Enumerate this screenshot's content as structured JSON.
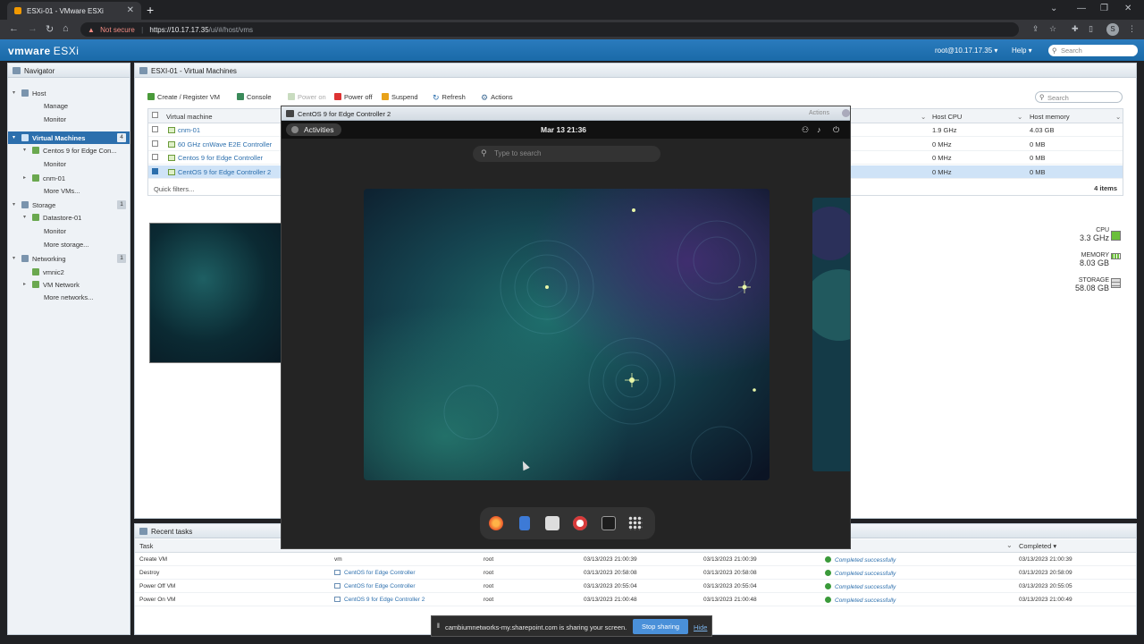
{
  "browser": {
    "tab_title": "ESXi-01 - VMware ESXi",
    "not_secure": "Not secure",
    "url_scheme": "https://",
    "url_host": "10.17.17.35",
    "url_path": "/ui/#/host/vms",
    "avatar_letter": "S"
  },
  "header": {
    "brand": "vmware",
    "product": "ESXi",
    "user": "root@10.17.17.35 ▾",
    "help": "Help ▾",
    "search_placeholder": "Search"
  },
  "navigator": {
    "title": "Navigator",
    "items": [
      {
        "label": "Host",
        "level": 0,
        "toggle": "▾"
      },
      {
        "label": "Manage",
        "level": 2
      },
      {
        "label": "Monitor",
        "level": 2
      },
      {
        "label": "Virtual Machines",
        "level": 0,
        "toggle": "▾",
        "badge": "4",
        "selected": true
      },
      {
        "label": "Centos 9 for Edge Con...",
        "level": 1,
        "toggle": "▾"
      },
      {
        "label": "Monitor",
        "level": 2
      },
      {
        "label": "cnm-01",
        "level": 1,
        "toggle": "▸"
      },
      {
        "label": "More VMs...",
        "level": 2
      },
      {
        "label": "Storage",
        "level": 0,
        "toggle": "▾",
        "badge": "1"
      },
      {
        "label": "Datastore-01",
        "level": 1,
        "toggle": "▾"
      },
      {
        "label": "Monitor",
        "level": 2
      },
      {
        "label": "More storage...",
        "level": 2
      },
      {
        "label": "Networking",
        "level": 0,
        "toggle": "▾",
        "badge": "1"
      },
      {
        "label": "vmnic2",
        "level": 1
      },
      {
        "label": "VM Network",
        "level": 1,
        "toggle": "▸"
      },
      {
        "label": "More networks...",
        "level": 2
      }
    ]
  },
  "main": {
    "title": "ESXI-01 - Virtual Machines",
    "toolbar": {
      "create": "Create / Register VM",
      "console": "Console",
      "power_on": "Power on",
      "power_off": "Power off",
      "suspend": "Suspend",
      "refresh": "Refresh",
      "actions": "Actions"
    },
    "search_placeholder": "Search",
    "columns": {
      "vm": "Virtual machine",
      "cpu": "Host CPU",
      "mem": "Host memory"
    },
    "rows": [
      {
        "name": "cnm-01",
        "cpu": "1.9 GHz",
        "mem": "4.03 GB",
        "checked": false,
        "selected": false
      },
      {
        "name": "60 GHz cnWave E2E Controller",
        "cpu": "0 MHz",
        "mem": "0 MB",
        "checked": false,
        "selected": false
      },
      {
        "name": "Centos 9 for Edge Controller",
        "cpu": "0 MHz",
        "mem": "0 MB",
        "checked": false,
        "selected": false
      },
      {
        "name": "CentOS 9 for Edge Controller 2",
        "cpu": "0 MHz",
        "mem": "0 MB",
        "checked": true,
        "selected": true
      }
    ],
    "quick_filters": "Quick filters...",
    "item_count": "4 items",
    "resources": {
      "cpu_label": "CPU",
      "cpu_value": "3.3 GHz",
      "mem_label": "MEMORY",
      "mem_value": "8.03 GB",
      "storage_label": "STORAGE",
      "storage_value": "58.08 GB"
    }
  },
  "tasks": {
    "title": "Recent tasks",
    "columns": {
      "task": "Task",
      "completed": "Completed ▾"
    },
    "rows": [
      {
        "task": "Create VM",
        "target": "vm",
        "initiator": "root",
        "queued": "03/13/2023 21:00:39",
        "started": "03/13/2023 21:00:39",
        "result": "Completed successfully",
        "completed": "03/13/2023 21:00:39",
        "target_link": false
      },
      {
        "task": "Destroy",
        "target": "CentOS for Edge Controller",
        "initiator": "root",
        "queued": "03/13/2023 20:58:08",
        "started": "03/13/2023 20:58:08",
        "result": "Completed successfully",
        "completed": "03/13/2023 20:58:09",
        "target_link": true
      },
      {
        "task": "Power Off VM",
        "target": "CentOS for Edge Controller",
        "initiator": "root",
        "queued": "03/13/2023 20:55:04",
        "started": "03/13/2023 20:55:04",
        "result": "Completed successfully",
        "completed": "03/13/2023 20:55:05",
        "target_link": true
      },
      {
        "task": "Power On VM",
        "target": "CentOS 9 for Edge Controller 2",
        "initiator": "root",
        "queued": "03/13/2023 21:00:48",
        "started": "03/13/2023 21:00:48",
        "result": "Completed successfully",
        "completed": "03/13/2023 21:00:49",
        "target_link": true
      }
    ]
  },
  "console": {
    "title": "CentOS 9 for Edge Controller 2",
    "actions": "Actions",
    "activities": "Activities",
    "clock": "Mar 13  21:36",
    "search_placeholder": "Type to search"
  },
  "share": {
    "message": "cambiumnetworks-my.sharepoint.com is sharing your screen.",
    "stop": "Stop sharing",
    "hide": "Hide"
  },
  "colors": {
    "esxi_blue": "#1a6aa8",
    "selection": "#2c6fad",
    "ok_green": "#3a9a3a"
  }
}
